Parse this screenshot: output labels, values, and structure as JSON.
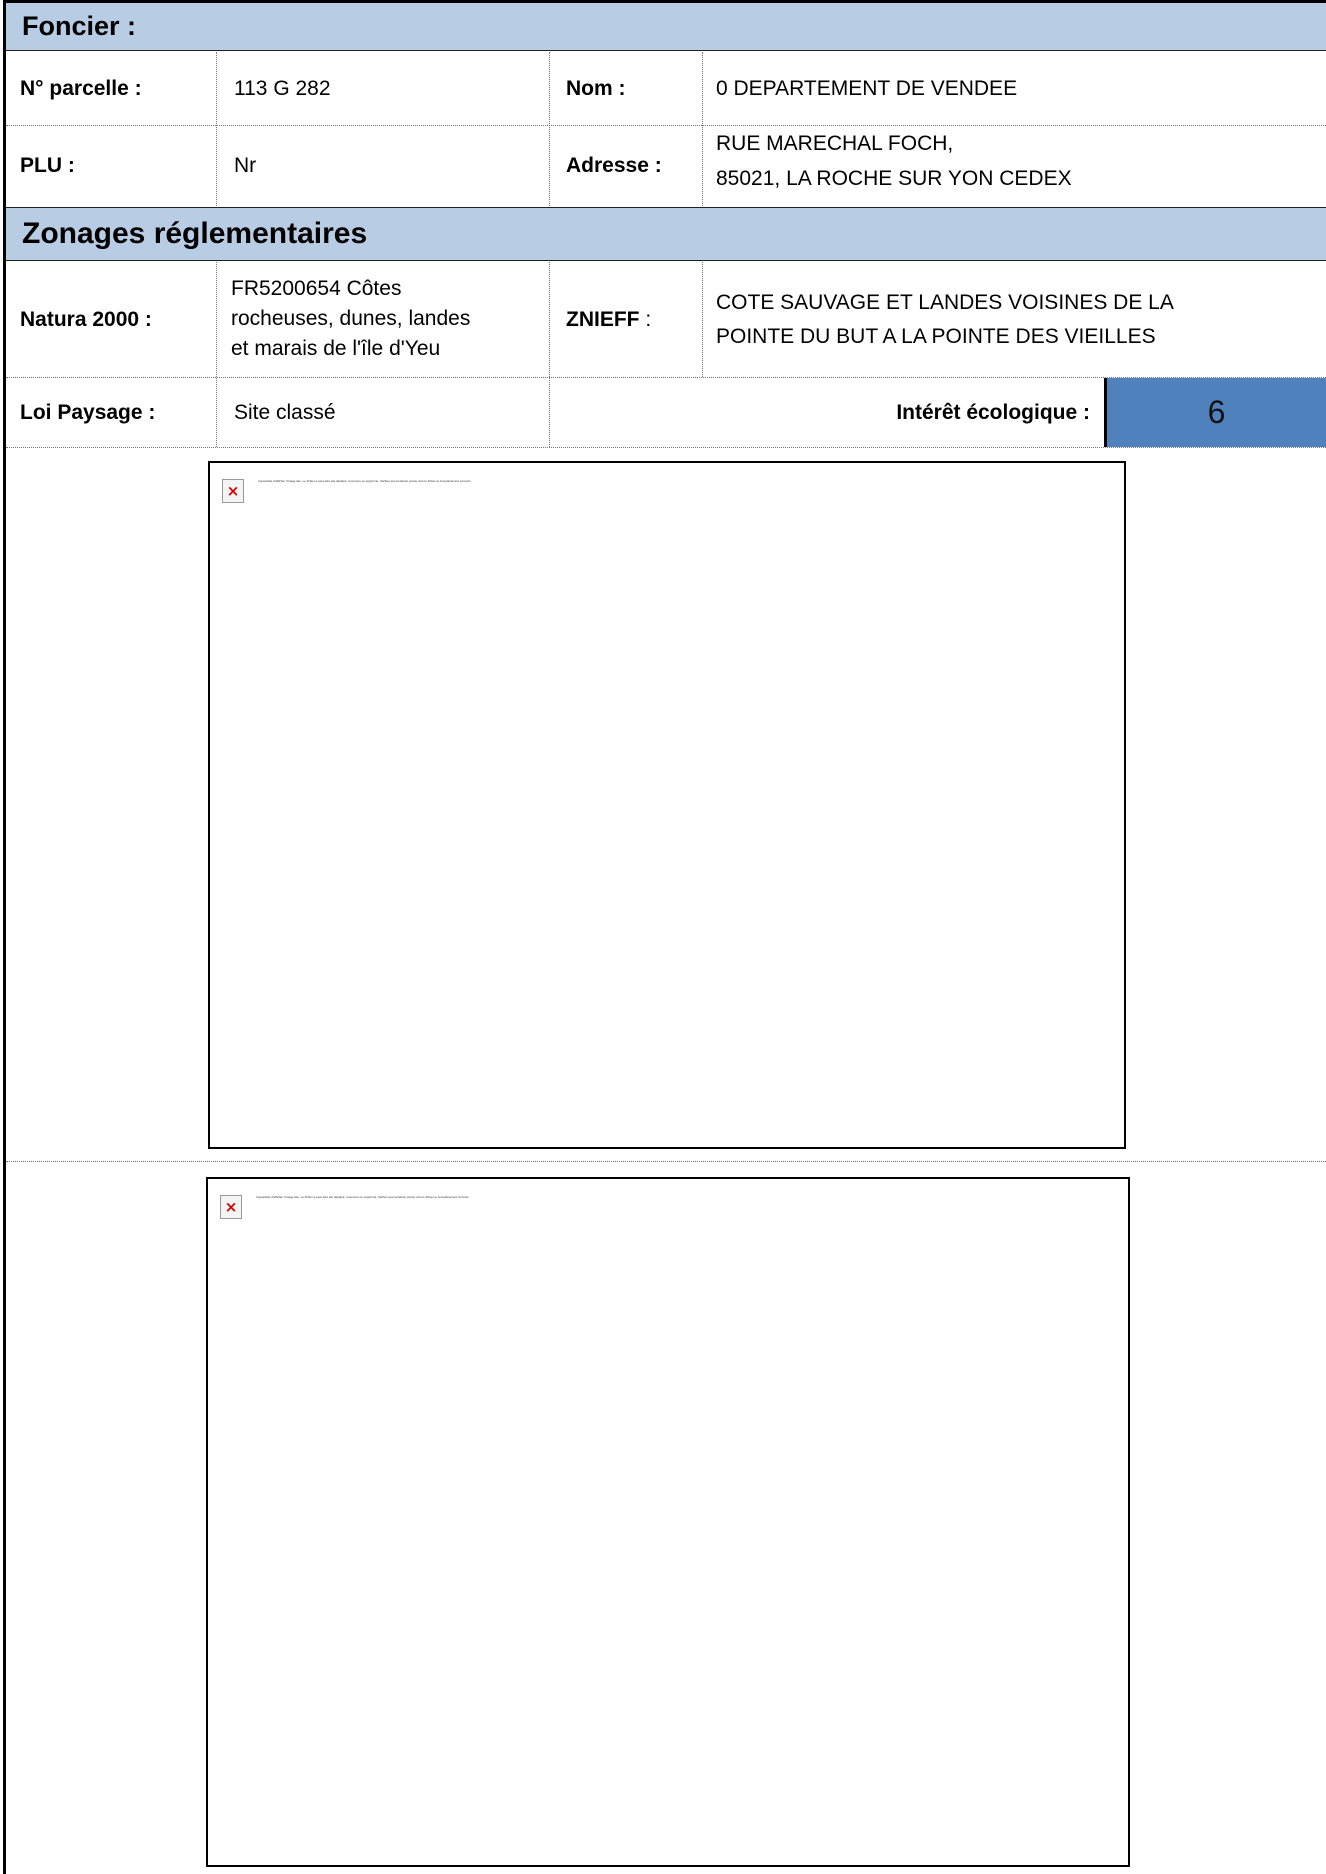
{
  "foncier": {
    "header": "Foncier :",
    "parcel_label": "N° parcelle :",
    "parcel_value": "113 G 282",
    "nom_label": "Nom :",
    "nom_value": "0 DEPARTEMENT DE VENDEE",
    "plu_label": "PLU :",
    "plu_value": "Nr",
    "adresse_label": "Adresse :",
    "adresse_line1": "RUE MARECHAL FOCH,",
    "adresse_line2": "85021, LA ROCHE SUR YON CEDEX"
  },
  "zonages": {
    "header": "Zonages réglementaires",
    "natura_label": "Natura 2000 :",
    "natura_line1": "FR5200654 Côtes",
    "natura_line2": "rocheuses, dunes, landes",
    "natura_line3": "et marais de l'île d'Yeu",
    "znieff_label": "ZNIEFF",
    "znieff_colon": " :",
    "znieff_line1": "COTE SAUVAGE ET LANDES VOISINES DE LA",
    "znieff_line2": "POINTE DU BUT A LA POINTE DES VIEILLES",
    "loi_label": "Loi Paysage :",
    "loi_value": "Site classé",
    "interet_label": "Intérêt écologique :",
    "interet_value": "6"
  },
  "images": {
    "broken_icon": "broken-image-icon",
    "broken_glyph": "×",
    "message_1": "Impossible d'afficher l'image liée. Le fichier a peut-être été déplacé, renommé ou supprimé. Vérifiez que la liaison pointe vers le fichier et l'emplacement corrects.",
    "message_2": "Impossible d'afficher l'image liée. Le fichier a peut-être été déplacé, renommé ou supprimé. Vérifiez que la liaison pointe vers le fichier et l'emplacement corrects."
  },
  "colors": {
    "band": "#b8cce4",
    "score_fill": "#4f81bd"
  }
}
